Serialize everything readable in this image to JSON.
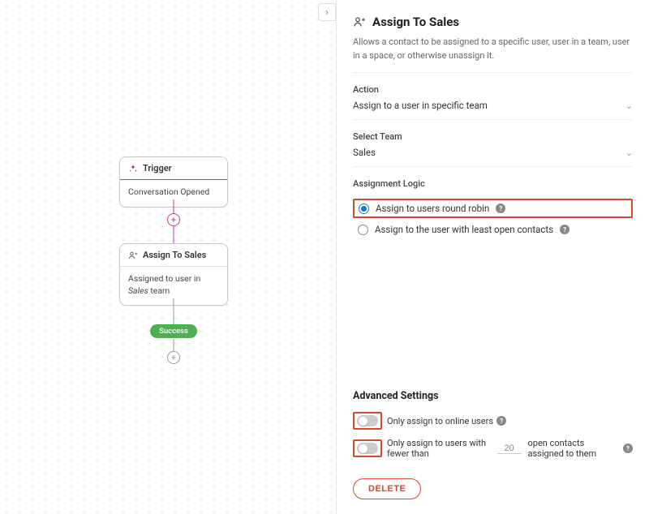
{
  "canvas": {
    "trigger": {
      "title": "Trigger",
      "body": "Conversation Opened"
    },
    "assign": {
      "title": "Assign To Sales",
      "body_prefix": "Assigned to user in ",
      "body_team": "Sales",
      "body_suffix": " team"
    },
    "success_label": "Success"
  },
  "panel": {
    "title": "Assign To Sales",
    "description": "Allows a contact to be assigned to a specific user, user in a team, user in a space, or otherwise unassign it.",
    "action_label": "Action",
    "action_value": "Assign to a user in specific team",
    "team_label": "Select Team",
    "team_value": "Sales",
    "logic_label": "Assignment Logic",
    "logic_options": {
      "round_robin": "Assign to users round robin",
      "least_open": "Assign to the user with least open contacts"
    },
    "advanced_title": "Advanced Settings",
    "adv_online": "Only assign to online users",
    "adv_fewer_prefix": "Only assign to users with fewer than",
    "adv_fewer_value": "20",
    "adv_fewer_suffix": "open contacts assigned to them",
    "delete_label": "DELETE"
  }
}
